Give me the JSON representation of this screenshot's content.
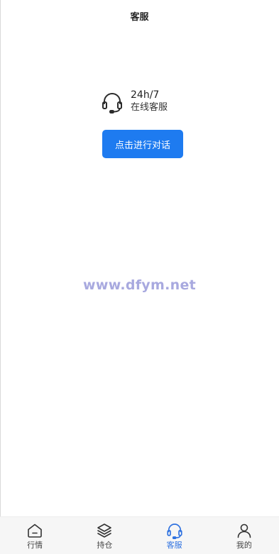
{
  "header": {
    "title": "客服"
  },
  "support": {
    "icon": "headset-icon",
    "hours": "24h/7",
    "description": "在线客服",
    "button_label": "点击进行对话",
    "button_color": "#1e7bf0"
  },
  "watermark": {
    "text": "www.dfym.net",
    "color": "#a8a9df"
  },
  "tabbar": {
    "active_color": "#2f72e0",
    "items": [
      {
        "label": "行情",
        "icon": "home-icon",
        "active": false
      },
      {
        "label": "持仓",
        "icon": "layers-icon",
        "active": false
      },
      {
        "label": "客服",
        "icon": "headset-icon",
        "active": true
      },
      {
        "label": "我的",
        "icon": "user-icon",
        "active": false
      }
    ]
  }
}
